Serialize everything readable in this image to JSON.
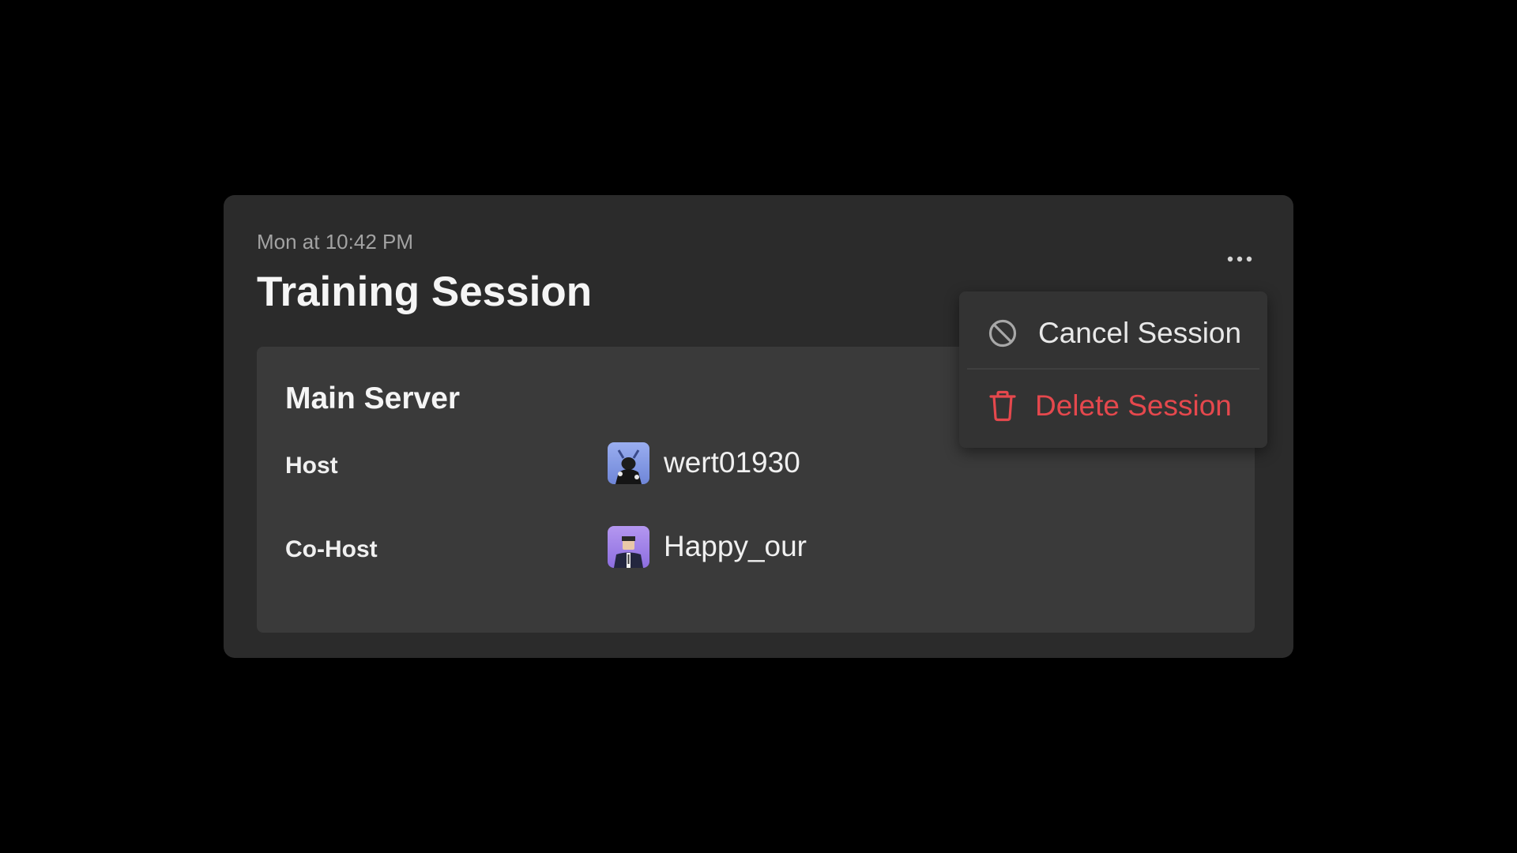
{
  "session": {
    "timestamp": "Mon at 10:42 PM",
    "title": "Training Session"
  },
  "server": {
    "name": "Main Server",
    "rows": [
      {
        "label": "Host",
        "username": "wert01930",
        "avatar_icon": "user-avatar-wert01930"
      },
      {
        "label": "Co-Host",
        "username": "Happy_our",
        "avatar_icon": "user-avatar-happy-our"
      }
    ]
  },
  "menu": {
    "trigger_icon": "more-horizontal-icon",
    "items": [
      {
        "label": "Cancel Session",
        "icon": "ban-icon",
        "color": "#e8e8e8"
      },
      {
        "label": "Delete Session",
        "icon": "trash-icon",
        "color": "#e5484d"
      }
    ]
  },
  "colors": {
    "background": "#000000",
    "card": "#2b2b2b",
    "inner_panel": "#3a3a3a",
    "menu": "#333333",
    "danger": "#e5484d"
  }
}
